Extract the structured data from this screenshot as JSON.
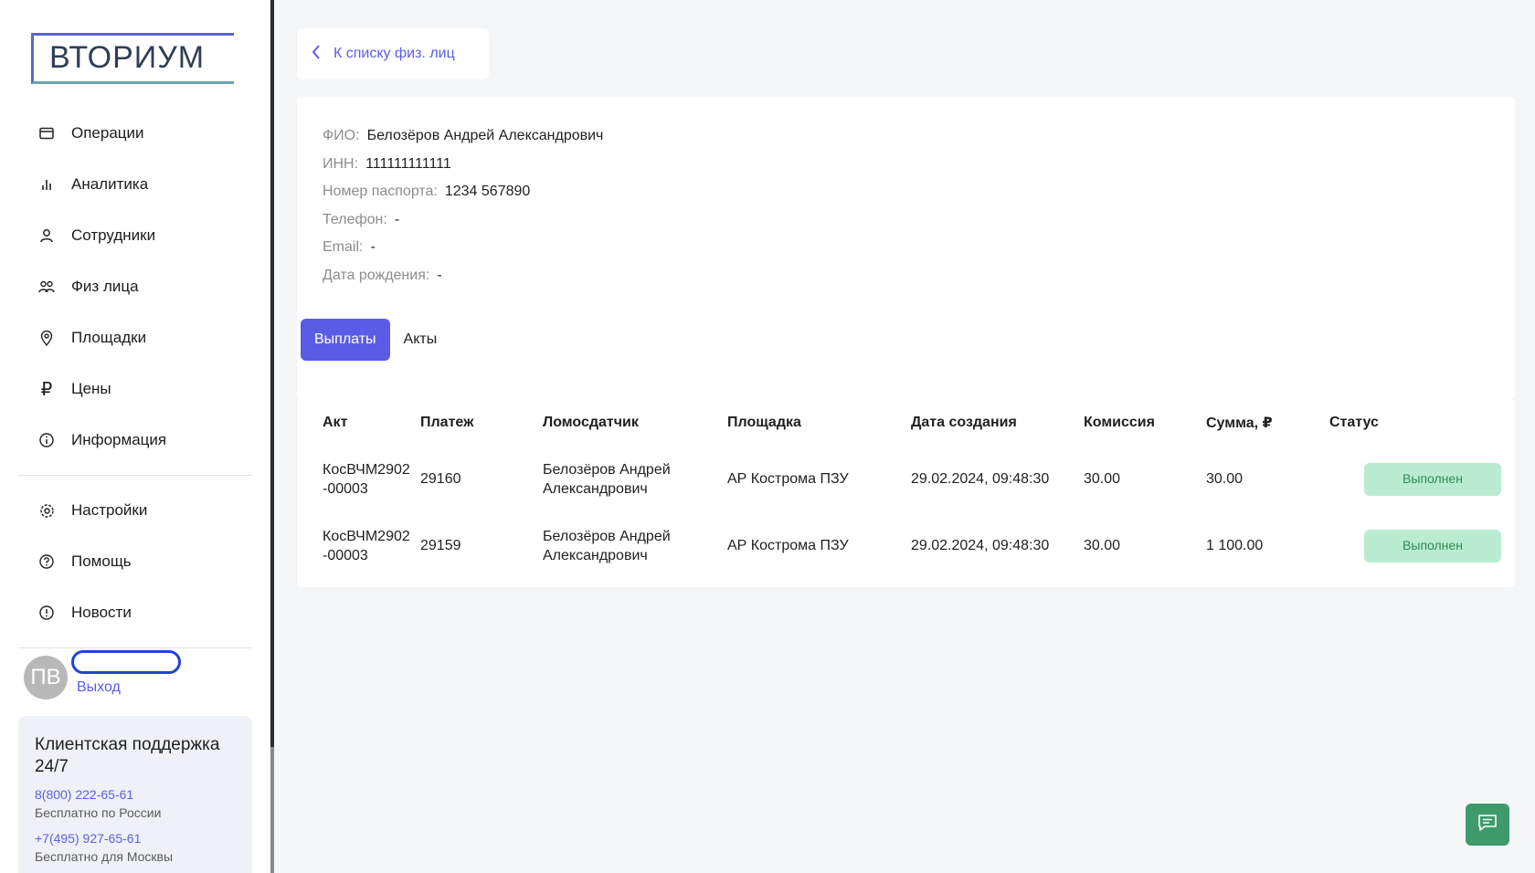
{
  "brand": {
    "logo_text": "ВТОРИУМ"
  },
  "nav": {
    "items": [
      {
        "label": "Операции",
        "icon": "card-icon"
      },
      {
        "label": "Аналитика",
        "icon": "bar-chart-icon"
      },
      {
        "label": "Сотрудники",
        "icon": "user-icon"
      },
      {
        "label": "Физ лица",
        "icon": "users-icon"
      },
      {
        "label": "Площадки",
        "icon": "location-pin-icon"
      },
      {
        "label": "Цены",
        "icon": "ruble-icon"
      },
      {
        "label": "Информация",
        "icon": "info-icon"
      }
    ],
    "secondary": [
      {
        "label": "Настройки",
        "icon": "gear-icon"
      },
      {
        "label": "Помощь",
        "icon": "help-icon"
      },
      {
        "label": "Новости",
        "icon": "alert-icon"
      }
    ]
  },
  "user": {
    "initials": "ПВ",
    "logout_label": "Выход"
  },
  "support": {
    "title": "Клиентская поддержка 24/7",
    "phone1": "8(800) 222-65-61",
    "note1": "Бесплатно по России",
    "phone2": "+7(495) 927-65-61",
    "note2": "Бесплатно для Москвы"
  },
  "back_link": "К списку физ. лиц",
  "person": {
    "fields": [
      {
        "label": "ФИО:",
        "value": "Белозёров Андрей Александрович"
      },
      {
        "label": "ИНН:",
        "value": "111111111111"
      },
      {
        "label": "Номер паспорта:",
        "value": "1234 567890"
      },
      {
        "label": "Телефон:",
        "value": "-"
      },
      {
        "label": "Email:",
        "value": "-"
      },
      {
        "label": "Дата рождения:",
        "value": "-"
      }
    ]
  },
  "tabs": [
    {
      "label": "Выплаты",
      "active": true
    },
    {
      "label": "Акты",
      "active": false
    }
  ],
  "table": {
    "columns": [
      "Акт",
      "Платеж",
      "Ломосдатчик",
      "Площадка",
      "Дата создания",
      "Комиссия",
      "Сумма, ₽",
      "Статус"
    ],
    "rows": [
      {
        "act_line1": "КосВЧМ2902",
        "act_line2": "-00003",
        "payment": "29160",
        "supplier_line1": "Белозёров Андрей",
        "supplier_line2": "Александрович",
        "site": "АР Кострома ПЗУ",
        "created": "29.02.2024, 09:48:30",
        "commission": "30.00",
        "amount": "30.00",
        "status": "Выполнен"
      },
      {
        "act_line1": "КосВЧМ2902",
        "act_line2": "-00003",
        "payment": "29159",
        "supplier_line1": "Белозёров Андрей",
        "supplier_line2": "Александрович",
        "site": "АР Кострома ПЗУ",
        "created": "29.02.2024, 09:48:30",
        "commission": "30.00",
        "amount": "1 100.00",
        "status": "Выполнен"
      }
    ]
  },
  "colors": {
    "accent": "#5b5ce6",
    "status_bg": "#b9ecd0",
    "status_text": "#2e8b57",
    "chat_button": "#3f9a6b"
  }
}
